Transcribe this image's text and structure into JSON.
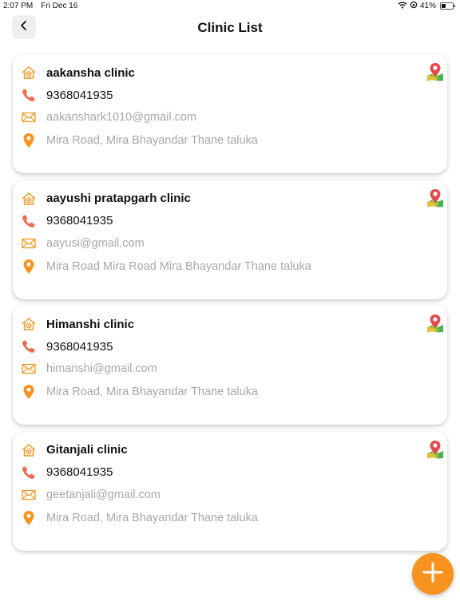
{
  "status_bar": {
    "time": "2:07 PM",
    "date": "Fri Dec 16",
    "battery": "41%",
    "battery_level": 0.41
  },
  "header": {
    "title": "Clinic List",
    "back_icon": "chevron-left-icon"
  },
  "colors": {
    "accent": "#f7931e",
    "secondary_text": "#a8a8a8",
    "map_pin_red": "#e5484d",
    "map_land_green": "#4caf50"
  },
  "clinics": [
    {
      "name": "aakansha clinic",
      "phone": "9368041935",
      "email": "aakanshark1010@gmail.com",
      "address": "Mira Road, Mira Bhayandar Thane taluka"
    },
    {
      "name": "aayushi pratapgarh clinic",
      "phone": "9368041935",
      "email": "aayusi@gmail.com",
      "address": "Mira Road Mira Road Mira Bhayandar Thane taluka"
    },
    {
      "name": "Himanshi clinic",
      "phone": "9368041935",
      "email": "himanshi@gmail.com",
      "address": "Mira Road, Mira Bhayandar Thane taluka"
    },
    {
      "name": "Gitanjali clinic",
      "phone": "9368041935",
      "email": "geetanjali@gmail.com",
      "address": "Mira Road, Mira Bhayandar Thane taluka"
    }
  ],
  "fab": {
    "icon": "plus-icon"
  }
}
